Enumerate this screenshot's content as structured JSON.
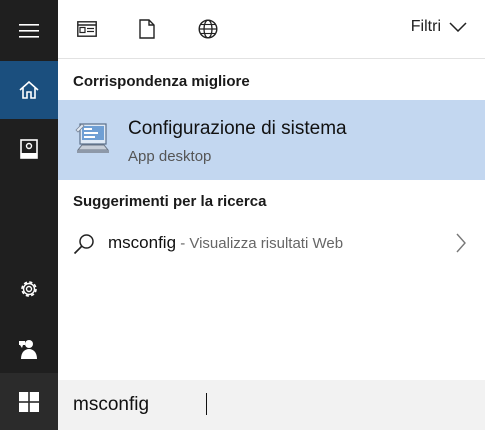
{
  "sidebar": {
    "items": [
      {
        "name": "menu",
        "icon": "hamburger-icon"
      },
      {
        "name": "home",
        "icon": "home-icon",
        "active": true
      },
      {
        "name": "notebook",
        "icon": "notebook-icon"
      },
      {
        "name": "settings",
        "icon": "gear-icon"
      },
      {
        "name": "feedback",
        "icon": "feedback-icon"
      },
      {
        "name": "start",
        "icon": "windows-logo-icon"
      }
    ]
  },
  "topbar": {
    "tabs": [
      {
        "name": "apps",
        "icon": "apps-filter-icon"
      },
      {
        "name": "documents",
        "icon": "document-icon"
      },
      {
        "name": "web",
        "icon": "globe-icon"
      }
    ],
    "filters_label": "Filtri"
  },
  "best_match": {
    "header": "Corrispondenza migliore",
    "title": "Configurazione di sistema",
    "subtitle": "App desktop",
    "icon": "system-config-icon"
  },
  "suggestions": {
    "header": "Suggerimenti per la ricerca",
    "items": [
      {
        "term": "msconfig",
        "detail": " - Visualizza risultati Web"
      }
    ]
  },
  "search": {
    "value": "msconfig"
  },
  "colors": {
    "sidebar_bg": "#1f1f1f",
    "active_bg": "#1b4f7e",
    "best_match_bg": "#c3d7f0",
    "search_bg": "#f2f2f2"
  }
}
